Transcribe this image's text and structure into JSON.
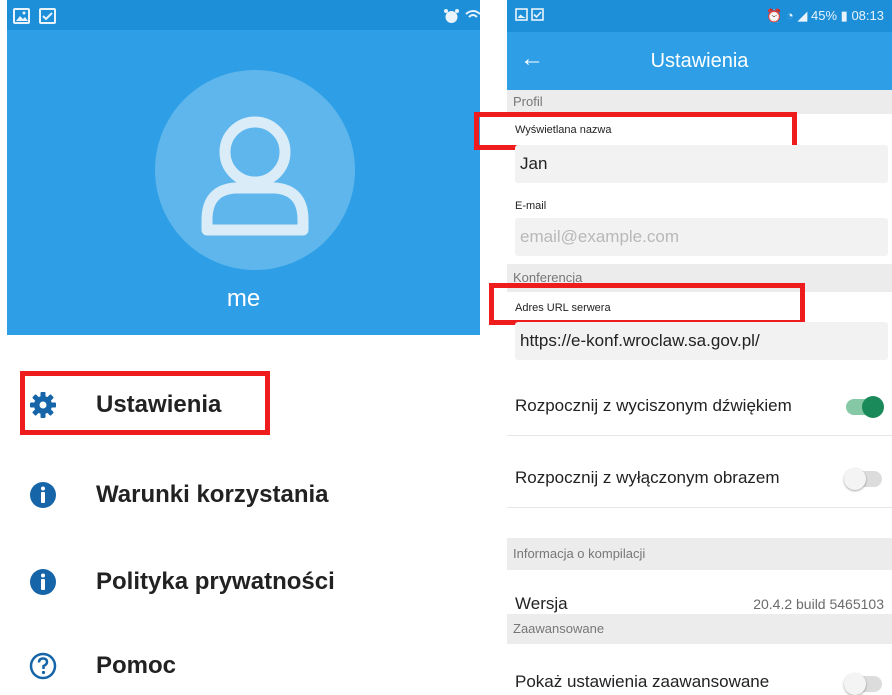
{
  "left": {
    "status_icons": [
      "image-icon",
      "checkbox-icon",
      "alarm-icon",
      "wifi-icon"
    ],
    "profile_name": "me",
    "menu": [
      {
        "label": "Ustawienia",
        "icon": "gear-icon"
      },
      {
        "label": "Warunki korzystania",
        "icon": "info-icon"
      },
      {
        "label": "Polityka prywatności",
        "icon": "info-icon"
      },
      {
        "label": "Pomoc",
        "icon": "help-icon"
      }
    ]
  },
  "right": {
    "status": {
      "battery": "45%",
      "time": "08:13"
    },
    "appbar": {
      "title": "Ustawienia"
    },
    "sections": {
      "profile": "Profil",
      "conference": "Konferencja",
      "build_info": "Informacja o kompilacji",
      "advanced": "Zaawansowane"
    },
    "fields": {
      "display_name_label": "Wyświetlana nazwa",
      "display_name_value": "Jan",
      "email_label": "E-mail",
      "email_placeholder": "email@example.com",
      "server_url_label": "Adres URL serwera",
      "server_url_value": "https://e-konf.wroclaw.sa.gov.pl/"
    },
    "toggles": {
      "start_muted_label": "Rozpocznij z wyciszonym dźwiękiem",
      "start_muted_on": true,
      "start_video_off_label": "Rozpocznij z wyłączonym obrazem",
      "start_video_off_on": false,
      "show_advanced_label": "Pokaż ustawienia zaawansowane",
      "show_advanced_on": false
    },
    "version": {
      "label": "Wersja",
      "value": "20.4.2 build 5465103"
    }
  },
  "colors": {
    "accent_blue": "#2e9fe6",
    "highlight_red": "#ee1c1c",
    "toggle_green": "#1b8a5a"
  }
}
